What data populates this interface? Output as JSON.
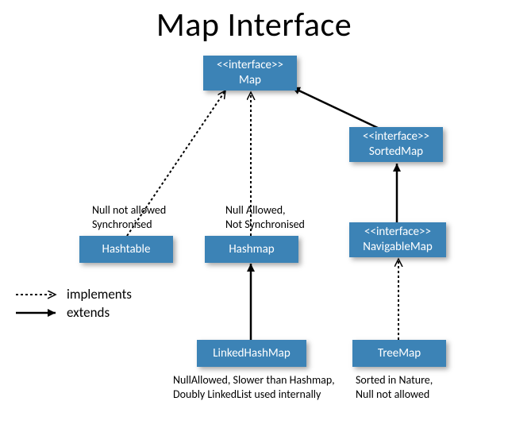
{
  "title": "Map Interface",
  "boxes": {
    "map": {
      "stereotype": "<<interface>>",
      "name": "Map"
    },
    "sortedMap": {
      "stereotype": "<<interface>>",
      "name": "SortedMap"
    },
    "navigableMap": {
      "stereotype": "<<interface>>",
      "name": "NavigableMap"
    },
    "hashtable": {
      "name": "Hashtable"
    },
    "hashmap": {
      "name": "Hashmap"
    },
    "linkedHashMap": {
      "name": "LinkedHashMap"
    },
    "treeMap": {
      "name": "TreeMap"
    }
  },
  "annotations": {
    "hashtable": "Null not allowed\nSynchronised",
    "hashmap": "Null Allowed,\nNot Synchronised",
    "linkedHashMap": "NullAllowed, Slower than Hashmap,\nDoubly LinkedList used internally",
    "treeMap": "Sorted in Nature,\nNull not allowed"
  },
  "legend": {
    "implements": "implements",
    "extends": "extends"
  },
  "relations": [
    {
      "from": "Hashtable",
      "to": "Map",
      "kind": "implements"
    },
    {
      "from": "Hashmap",
      "to": "Map",
      "kind": "implements"
    },
    {
      "from": "SortedMap",
      "to": "Map",
      "kind": "extends"
    },
    {
      "from": "NavigableMap",
      "to": "SortedMap",
      "kind": "extends"
    },
    {
      "from": "TreeMap",
      "to": "NavigableMap",
      "kind": "implements"
    },
    {
      "from": "LinkedHashMap",
      "to": "Hashmap",
      "kind": "extends"
    }
  ]
}
